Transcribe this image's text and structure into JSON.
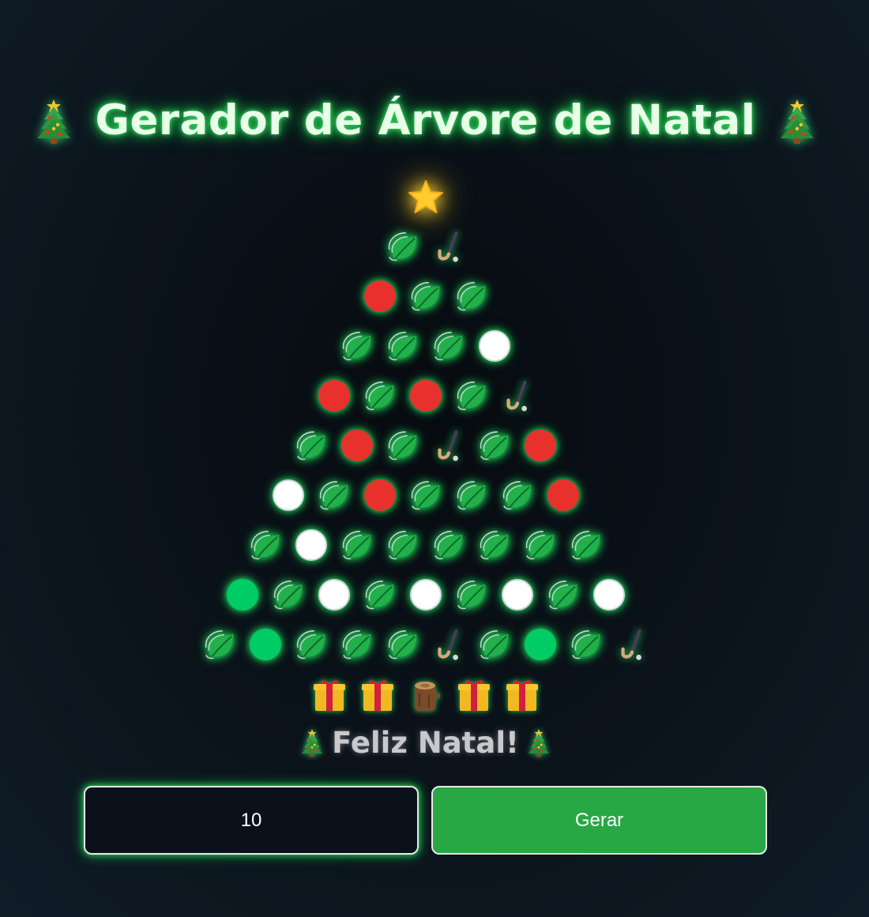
{
  "header": {
    "title": "Gerador de Árvore de Natal",
    "left_icon": "christmas-tree-icon",
    "right_icon": "christmas-tree-icon"
  },
  "tree": {
    "top": "star-icon",
    "rows": [
      [
        "leaf",
        "cane"
      ],
      [
        "red",
        "leaf",
        "leaf"
      ],
      [
        "leaf",
        "leaf",
        "leaf",
        "white"
      ],
      [
        "red",
        "leaf",
        "red",
        "leaf",
        "cane"
      ],
      [
        "leaf",
        "red",
        "leaf",
        "cane",
        "leaf",
        "red"
      ],
      [
        "white",
        "leaf",
        "red",
        "leaf",
        "leaf",
        "leaf",
        "red"
      ],
      [
        "leaf",
        "white",
        "leaf",
        "leaf",
        "leaf",
        "leaf",
        "leaf",
        "leaf"
      ],
      [
        "green",
        "leaf",
        "white",
        "leaf",
        "white",
        "leaf",
        "white",
        "leaf",
        "white"
      ],
      [
        "leaf",
        "green",
        "leaf",
        "leaf",
        "leaf",
        "cane",
        "leaf",
        "green",
        "leaf",
        "cane"
      ]
    ],
    "base": [
      "gift",
      "gift",
      "log",
      "gift",
      "gift"
    ]
  },
  "footer": {
    "message": "Feliz Natal!"
  },
  "controls": {
    "input_value": "10",
    "button_label": "Gerar"
  },
  "colors": {
    "ball_red": "#e8302c",
    "ball_white": "#ffffff",
    "ball_green": "#00cc66",
    "button": "#28a745",
    "glow": "#1fd15a"
  }
}
